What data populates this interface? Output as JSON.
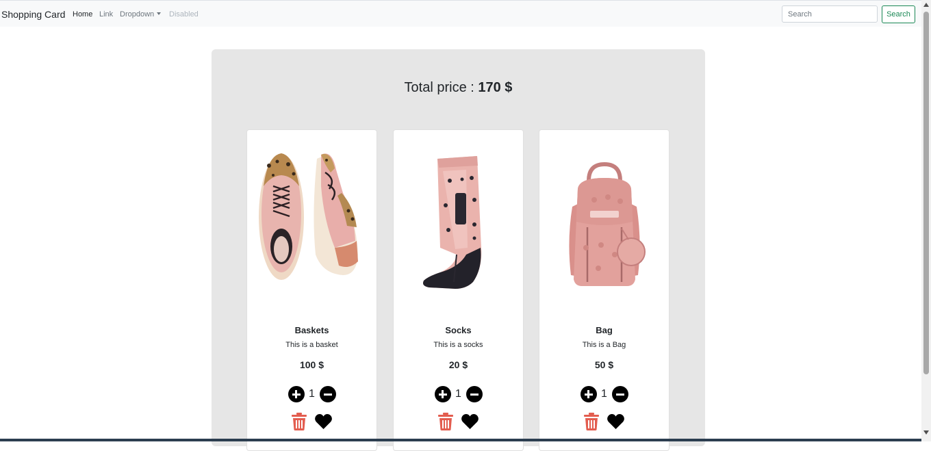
{
  "navbar": {
    "brand": "Shopping Card",
    "links": [
      {
        "label": "Home"
      },
      {
        "label": "Link"
      },
      {
        "label": "Dropdown"
      },
      {
        "label": "Disabled"
      }
    ],
    "search": {
      "placeholder": "Search",
      "value": ""
    },
    "search_button": "Search"
  },
  "cart": {
    "total_label": "Total price :",
    "total_value": "170 $",
    "products": [
      {
        "name": "Baskets",
        "description": "This is a basket",
        "price": "100 $",
        "quantity": "1",
        "image": "pink-sneakers-image"
      },
      {
        "name": "Socks",
        "description": "This is a socks",
        "price": "20 $",
        "quantity": "1",
        "image": "pink-sock-image"
      },
      {
        "name": "Bag",
        "description": "This is a Bag",
        "price": "50 $",
        "quantity": "1",
        "image": "pink-backpack-image"
      }
    ]
  },
  "colors": {
    "search_button": "#198754",
    "delete_icon": "#e35d4f",
    "heart_icon": "#000000",
    "panel": "#e6e6e6"
  }
}
